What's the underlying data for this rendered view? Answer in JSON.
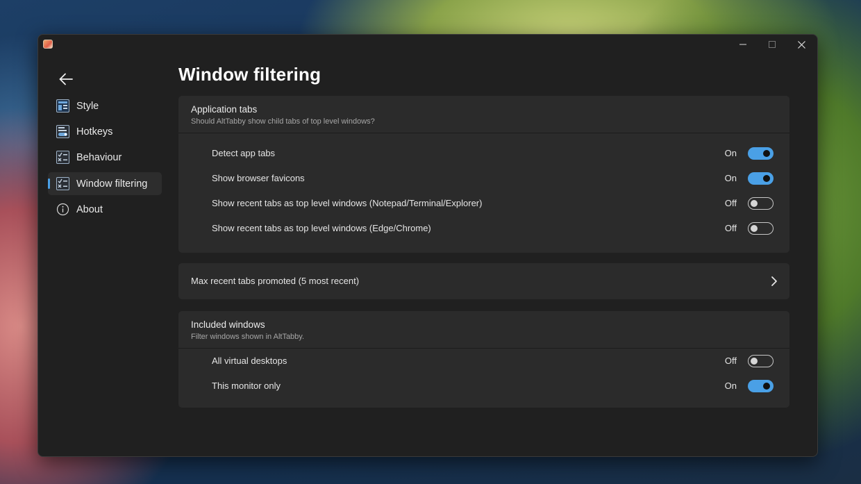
{
  "window": {
    "minimize": "minimize-icon",
    "maximize": "maximize-icon",
    "close": "close-icon"
  },
  "sidebar": {
    "back_icon": "back-arrow-icon",
    "items": [
      {
        "label": "Style",
        "icon": "style-icon"
      },
      {
        "label": "Hotkeys",
        "icon": "hotkeys-icon"
      },
      {
        "label": "Behaviour",
        "icon": "behaviour-icon"
      },
      {
        "label": "Window filtering",
        "icon": "filter-icon",
        "selected": true
      },
      {
        "label": "About",
        "icon": "info-icon"
      }
    ]
  },
  "page": {
    "title": "Window filtering"
  },
  "application_tabs": {
    "title": "Application tabs",
    "description": "Should AltTabby show child tabs of top level windows?",
    "settings": [
      {
        "label": "Detect app tabs",
        "state": "On",
        "on": true
      },
      {
        "label": "Show browser favicons",
        "state": "On",
        "on": true
      },
      {
        "label": "Show recent tabs as top level windows (Notepad/Terminal/Explorer)",
        "state": "Off",
        "on": false
      },
      {
        "label": "Show recent tabs as top level windows (Edge/Chrome)",
        "state": "Off",
        "on": false
      }
    ]
  },
  "max_recent": {
    "label": "Max recent tabs promoted  (5 most recent)"
  },
  "included_windows": {
    "title": "Included windows",
    "description": "Filter windows shown in AltTabby.",
    "settings": [
      {
        "label": "All virtual desktops",
        "state": "Off",
        "on": false
      },
      {
        "label": "This monitor only",
        "state": "On",
        "on": true
      }
    ]
  },
  "colors": {
    "accent": "#4aa0e6",
    "window_bg": "#202020",
    "card_bg": "#2b2b2b"
  }
}
